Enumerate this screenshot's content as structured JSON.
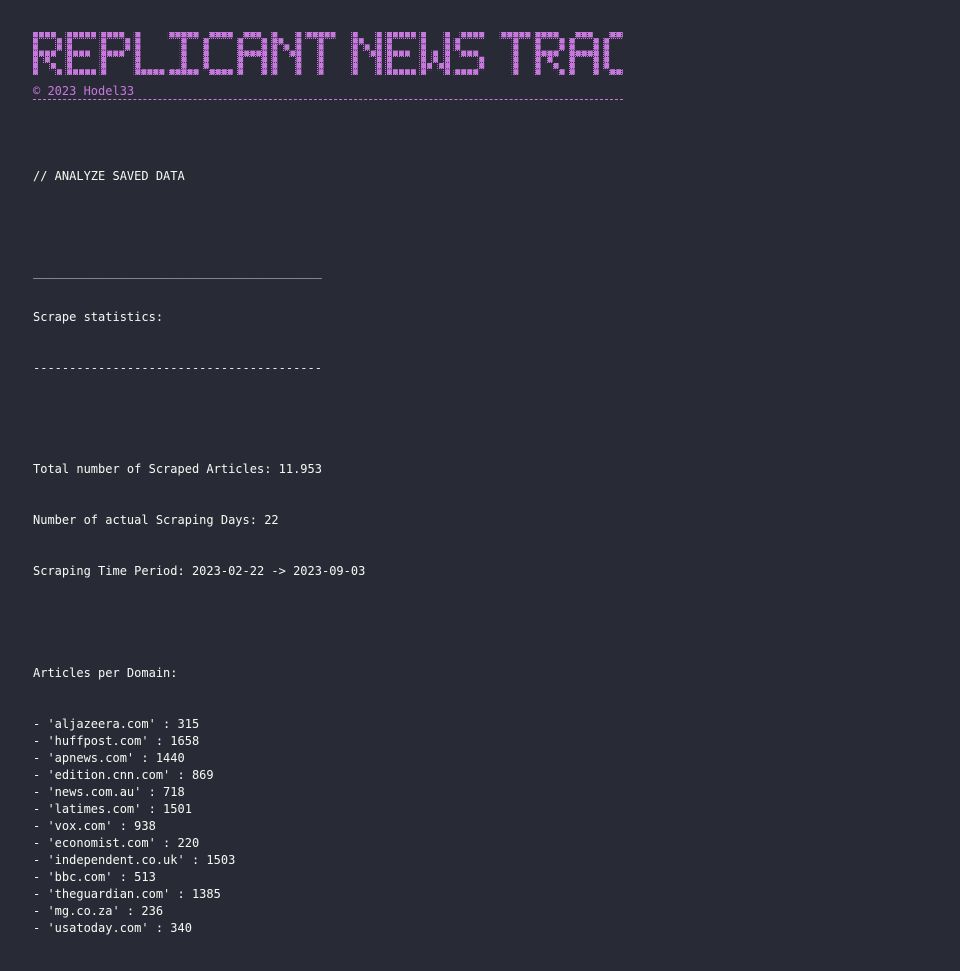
{
  "banner": {
    "title": "REPLICANT NEWS TRACKER",
    "copyright": "© 2023 Hodel33",
    "color": "#c678dd"
  },
  "section_heading": "// ANALYZE SAVED DATA",
  "rule_top": "________________________________________",
  "stats_title": "Scrape statistics:",
  "rule_bottom": "----------------------------------------",
  "stats": {
    "total_articles": "Total number of Scraped Articles: 11.953",
    "scraping_days": "Number of actual Scraping Days: 22",
    "time_period": "Scraping Time Period: 2023-02-22 -> 2023-09-03"
  },
  "domains_heading": "Articles per Domain:",
  "domains": [
    "- 'aljazeera.com' : 315",
    "- 'huffpost.com' : 1658",
    "- 'apnews.com' : 1440",
    "- 'edition.cnn.com' : 869",
    "- 'news.com.au' : 718",
    "- 'latimes.com' : 1501",
    "- 'vox.com' : 938",
    "- 'economist.com' : 220",
    "- 'independent.co.uk' : 1503",
    "- 'bbc.com' : 513",
    "- 'theguardian.com' : 1385",
    "- 'mg.co.za' : 236",
    "- 'usatoday.com' : 340"
  ]
}
